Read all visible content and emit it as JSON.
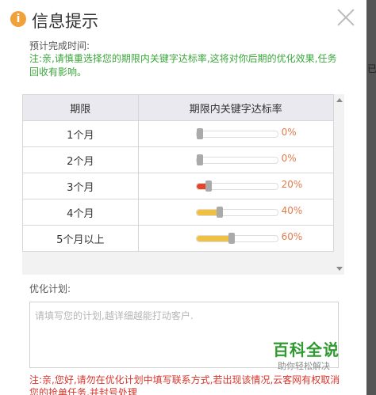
{
  "title": "信息提示",
  "side_fragment": "已",
  "time_label": "预计完成时间:",
  "note": "注:亲,请慎重选择您的期限内关键字达标率,这将对你后期的优化效果,任务回收有影响。",
  "table": {
    "headers": [
      "期限",
      "期限内关键字达标率"
    ],
    "rows": [
      {
        "period": "1个月",
        "rate": "0%",
        "value": 0,
        "color": "#aaaaaa"
      },
      {
        "period": "2个月",
        "rate": "0%",
        "value": 0,
        "color": "#aaaaaa"
      },
      {
        "period": "3个月",
        "rate": "20%",
        "value": 20,
        "color": "#e2452a"
      },
      {
        "period": "4个月",
        "rate": "40%",
        "value": 40,
        "color": "#f0c040"
      },
      {
        "period": "5个月以上",
        "rate": "60%",
        "value": 60,
        "color": "#f0c040"
      }
    ],
    "rate_text_color": "#e07b4a"
  },
  "plan_label": "优化计划:",
  "plan_placeholder": "请填写您的计划,越详细越能打动客户.",
  "plan_value": "",
  "warning": "注:亲,您好,请勿在优化计划中填写联系方式,若出现该情况,云客网有权取消您的抢单任务,并封号处理",
  "watermark": {
    "main": "百科全说",
    "sub": "助你轻松解决"
  },
  "colors": {
    "accent_green": "#3aa63a",
    "warning_red": "#d9342b",
    "info_orange": "#f0a13a"
  }
}
